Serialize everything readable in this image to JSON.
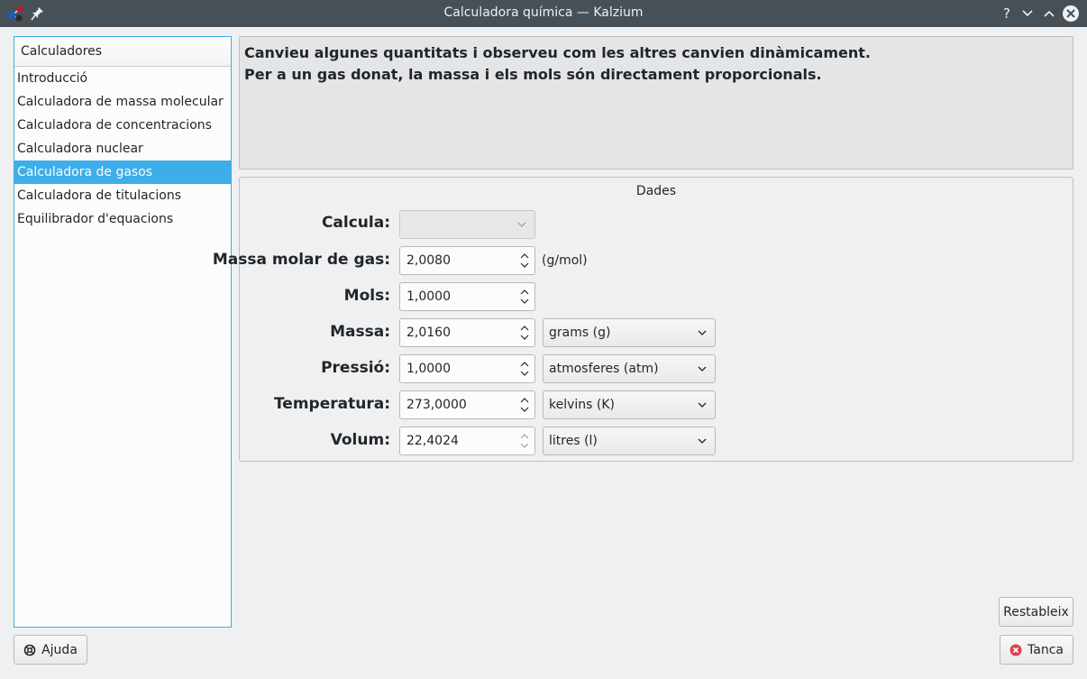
{
  "window": {
    "title": "Calculadora química — Kalzium",
    "help_symbol": "?"
  },
  "sidebar": {
    "header": "Calculadores",
    "items": [
      {
        "label": "Introducció",
        "selected": false
      },
      {
        "label": "Calculadora de massa molecular",
        "selected": false
      },
      {
        "label": "Calculadora de concentracions",
        "selected": false
      },
      {
        "label": "Calculadora nuclear",
        "selected": false
      },
      {
        "label": "Calculadora de gasos",
        "selected": true
      },
      {
        "label": "Calculadora de titulacions",
        "selected": false
      },
      {
        "label": "Equilibrador d'equacions",
        "selected": false
      }
    ]
  },
  "info": {
    "line1": "Canvieu algunes quantitats i observeu com les altres canvien dinàmicament.",
    "line2": "Per a un gas donat, la massa i els mols són directament proporcionals."
  },
  "dades": {
    "title": "Dades",
    "calcula": {
      "label": "Calcula:",
      "value": ""
    },
    "molar_mass": {
      "label": "Massa molar de gas:",
      "value": "2,0080",
      "unit": "(g/mol)"
    },
    "mols": {
      "label": "Mols:",
      "value": "1,0000"
    },
    "massa": {
      "label": "Massa:",
      "value": "2,0160",
      "unit": "grams (g)"
    },
    "pressio": {
      "label": "Pressió:",
      "value": "1,0000",
      "unit": "atmosferes (atm)"
    },
    "temperatura": {
      "label": "Temperatura:",
      "value": "273,0000",
      "unit": "kelvins (K)"
    },
    "volum": {
      "label": "Volum:",
      "value": "22,4024",
      "unit": "litres (l)"
    }
  },
  "buttons": {
    "reset": "Restableix",
    "help": "Ajuda",
    "close": "Tanca"
  },
  "colors": {
    "titlebar": "#475057",
    "accent": "#3daee9",
    "close_icon": "#da4453"
  }
}
